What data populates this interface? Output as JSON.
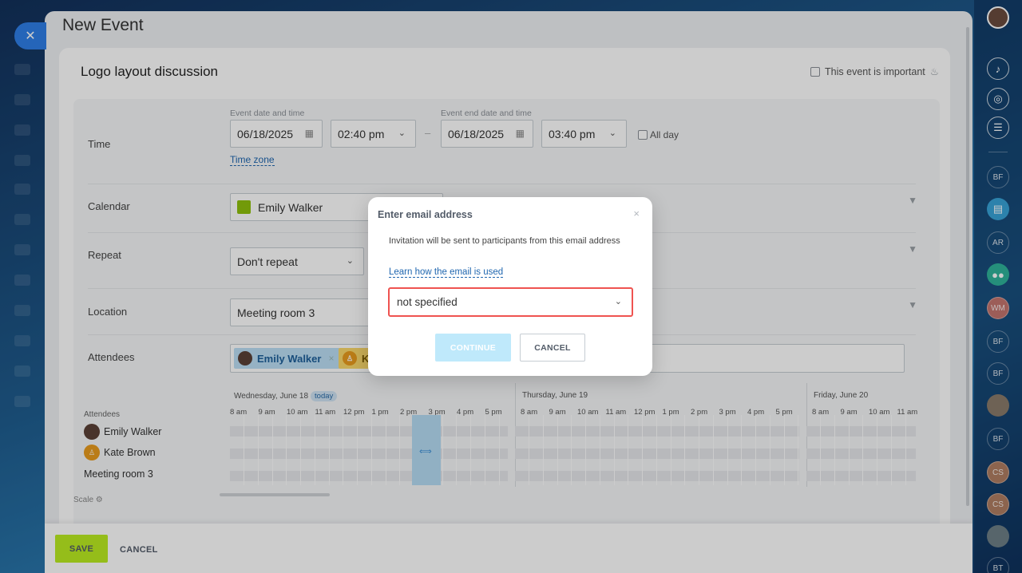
{
  "panel": {
    "title": "New Event"
  },
  "event": {
    "name": "Logo layout discussion",
    "important_label": "This event is important"
  },
  "time": {
    "label": "Time",
    "start_caption": "Event date and time",
    "end_caption": "Event end date and time",
    "start_date": "06/18/2025",
    "start_time": "02:40 pm",
    "end_date": "06/18/2025",
    "end_time": "03:40 pm",
    "separator": "–",
    "all_day": "All day",
    "timezone_link": "Time zone"
  },
  "calendar": {
    "label": "Calendar",
    "value": "Emily Walker",
    "color": "#8fc10c"
  },
  "repeat": {
    "label": "Repeat",
    "value": "Don't repeat"
  },
  "location": {
    "label": "Location",
    "value": "Meeting room 3"
  },
  "attendees": {
    "label": "Attendees",
    "tags": [
      {
        "name": "Emily Walker",
        "remove": "×"
      },
      {
        "name": "K",
        "remove": ""
      }
    ]
  },
  "timeline": {
    "days": [
      {
        "label": "Wednesday, June 18",
        "badge": "today"
      },
      {
        "label": "Thursday, June 19"
      },
      {
        "label": "Friday, June 20"
      }
    ],
    "hours_day1": [
      "8 am",
      "9 am",
      "10 am",
      "11 am",
      "12 pm",
      "1 pm",
      "2 pm",
      "3 pm",
      "4 pm",
      "5 pm"
    ],
    "hours_day2": [
      "8 am",
      "9 am",
      "10 am",
      "11 am",
      "12 pm",
      "1 pm",
      "2 pm",
      "3 pm",
      "4 pm",
      "5 pm"
    ],
    "hours_day3": [
      "8 am",
      "9 am",
      "10 am",
      "11 am"
    ],
    "attendees_header": "Attendees",
    "rows": [
      "Emily Walker",
      "Kate Brown",
      "Meeting room 3"
    ],
    "scale": "Scale"
  },
  "footer": {
    "save": "SAVE",
    "cancel": "CANCEL"
  },
  "dialog": {
    "title": "Enter email address",
    "close": "×",
    "text": "Invitation will be sent to participants from this email address",
    "link": "Learn how the email is used",
    "select_value": "not specified",
    "continue": "CONTINUE",
    "cancel": "CANCEL",
    "highlight_color": "#ef5350"
  },
  "rail": {
    "avatars": [
      "BF",
      "AR",
      "WM",
      "BF",
      "BF",
      "BF",
      "CS",
      "CS",
      "BT"
    ]
  }
}
